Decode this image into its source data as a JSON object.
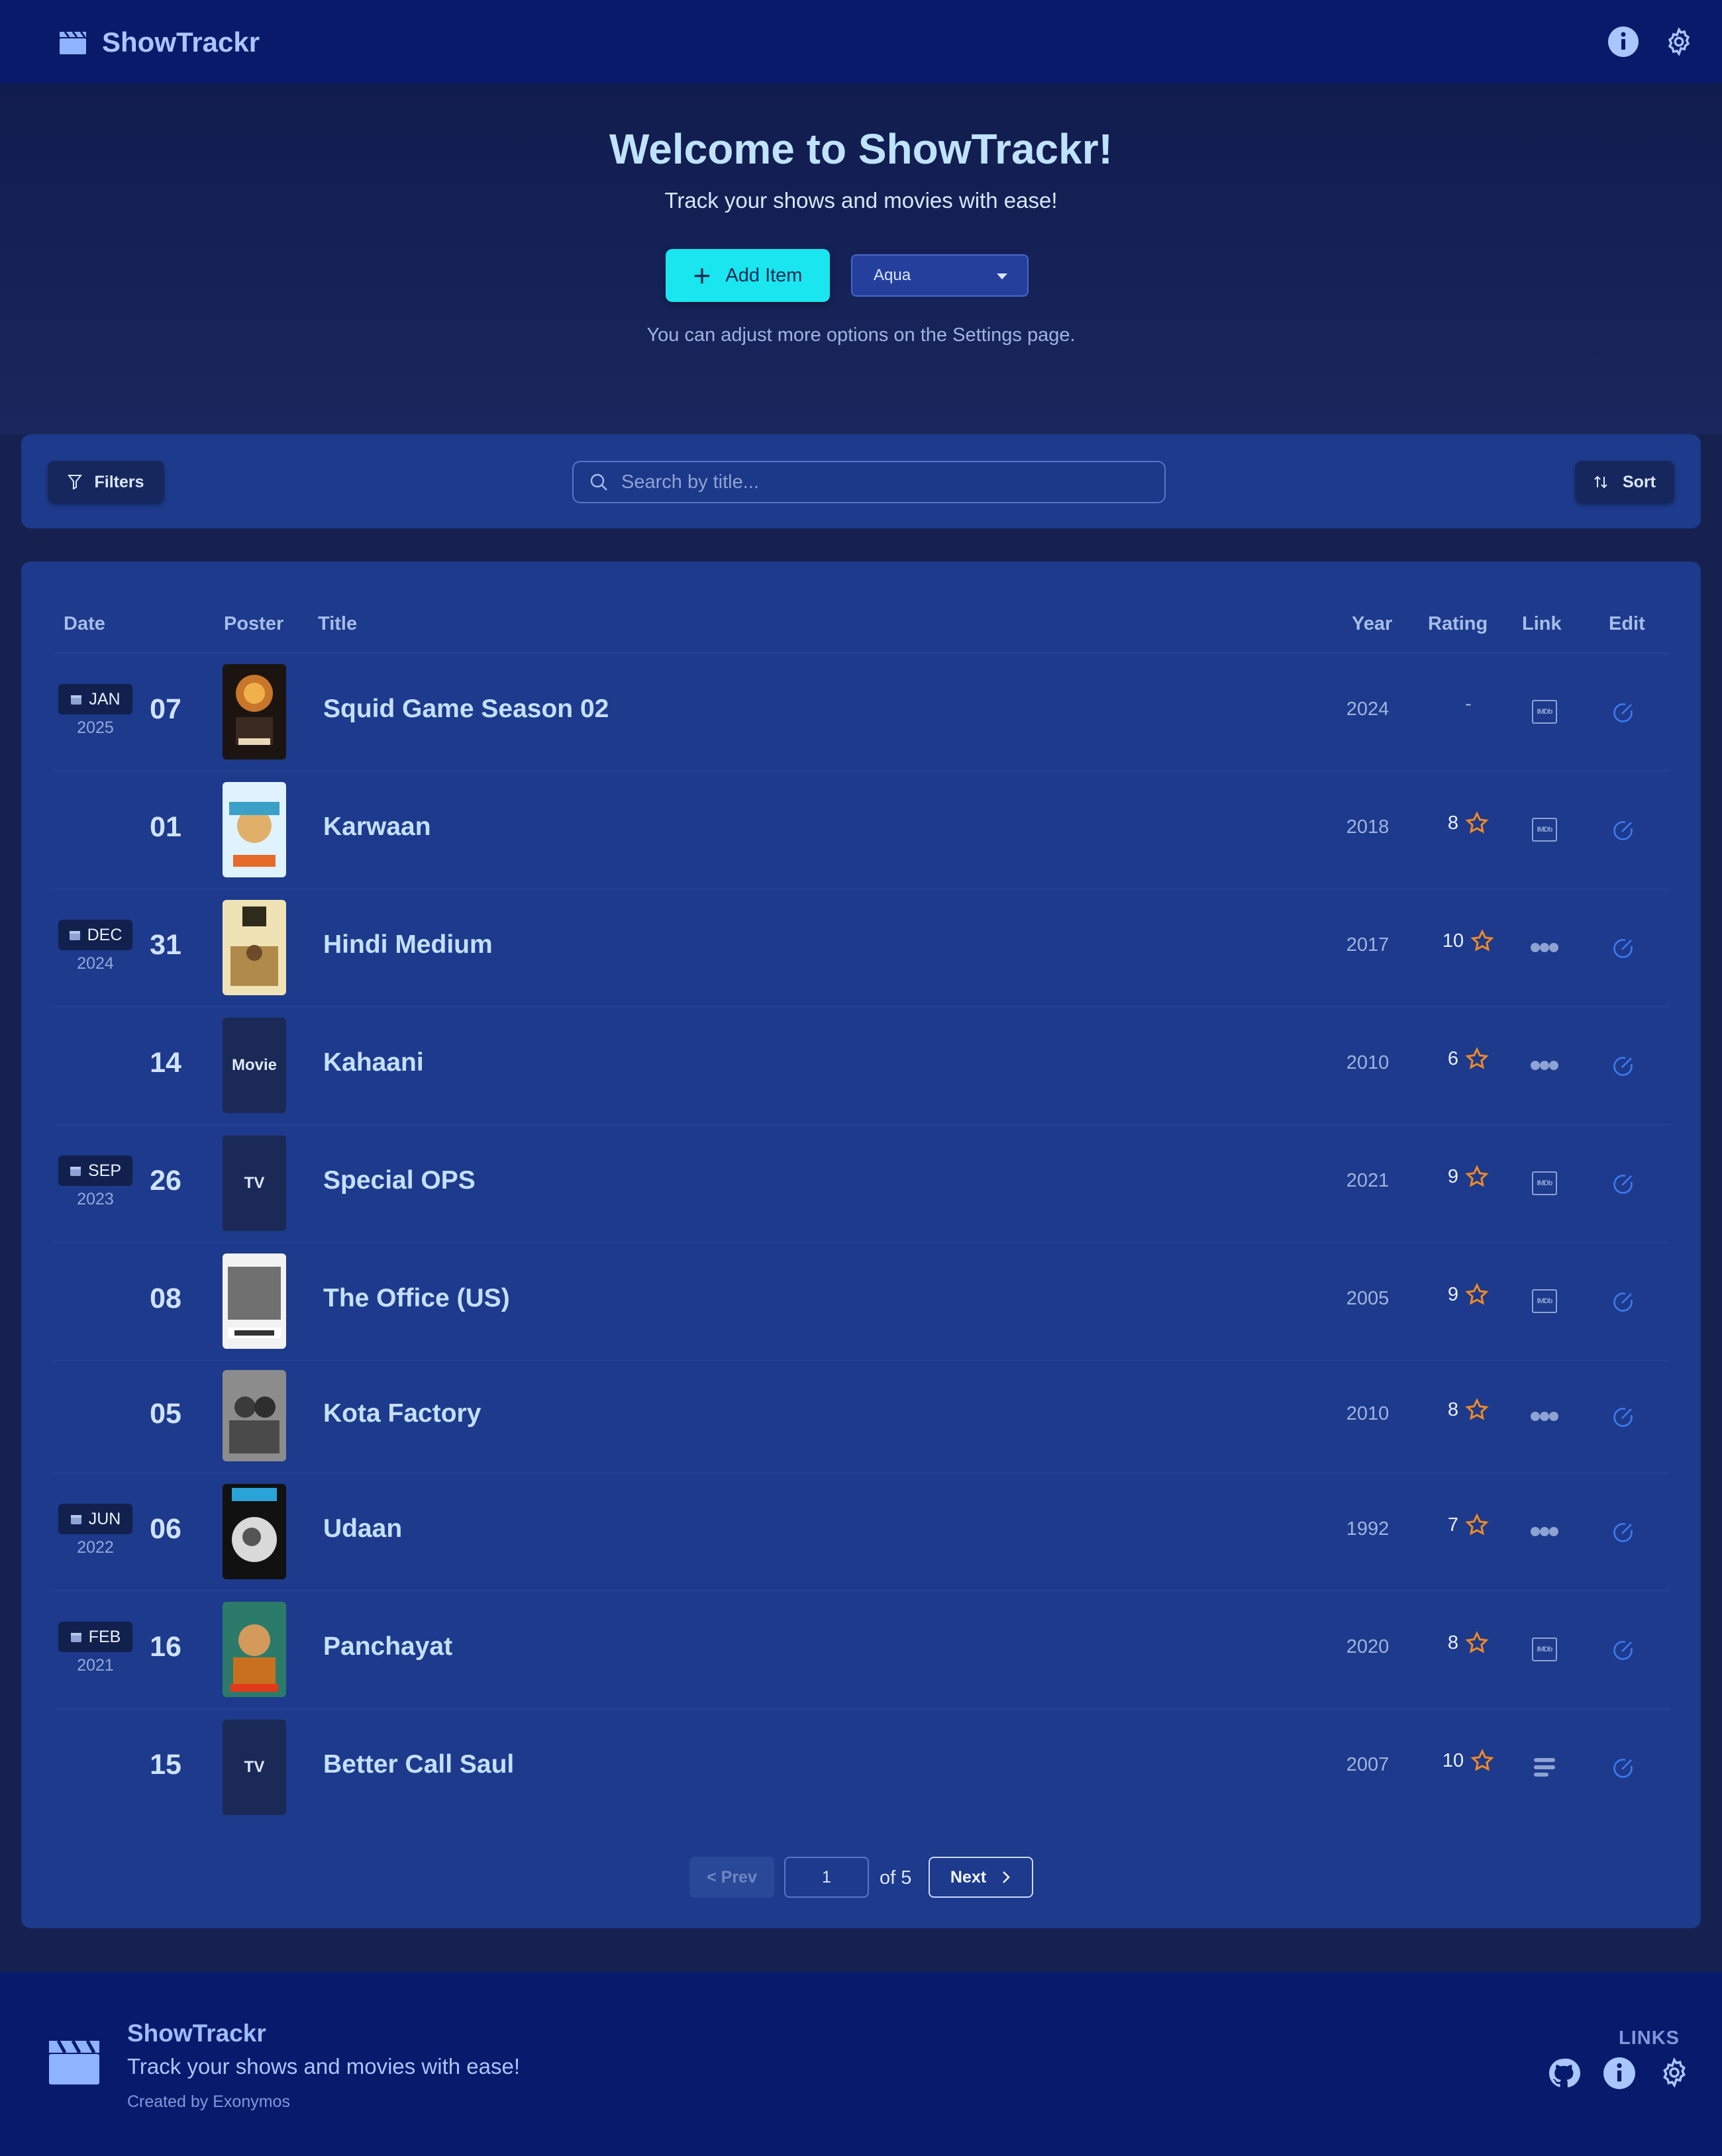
{
  "header": {
    "app_name": "ShowTrackr",
    "icons": [
      "clapperboard-icon",
      "info-icon",
      "settings-icon"
    ]
  },
  "hero": {
    "title": "Welcome to ShowTrackr!",
    "subtitle": "Track your shows and movies with ease!",
    "add_label": "Add Item",
    "theme_value": "Aqua",
    "note": "You can adjust more options on the Settings page."
  },
  "toolbar": {
    "filters_label": "Filters",
    "search_placeholder": "Search by title...",
    "sort_label": "Sort"
  },
  "table": {
    "columns": [
      "Date",
      "Poster",
      "Title",
      "Year",
      "Rating",
      "Link",
      "Edit"
    ],
    "rows": [
      {
        "month": "JAN",
        "year_group": "2025",
        "day": "07",
        "poster": "image",
        "title": "Squid Game Season 02",
        "year": "2024",
        "rating": "-",
        "link": "IMDb"
      },
      {
        "month": "",
        "year_group": "",
        "day": "01",
        "poster": "image",
        "title": "Karwaan",
        "year": "2018",
        "rating": "8",
        "link": "IMDb"
      },
      {
        "month": "DEC",
        "year_group": "2024",
        "day": "31",
        "poster": "image",
        "title": "Hindi Medium",
        "year": "2017",
        "rating": "10",
        "link": "Letterboxd"
      },
      {
        "month": "",
        "year_group": "",
        "day": "14",
        "poster": "Movie",
        "title": "Kahaani",
        "year": "2010",
        "rating": "6",
        "link": "Letterboxd"
      },
      {
        "month": "SEP",
        "year_group": "2023",
        "day": "26",
        "poster": "TV",
        "title": "Special OPS",
        "year": "2021",
        "rating": "9",
        "link": "IMDb"
      },
      {
        "month": "",
        "year_group": "",
        "day": "08",
        "poster": "image",
        "title": "The Office (US)",
        "year": "2005",
        "rating": "9",
        "link": "IMDb"
      },
      {
        "month": "",
        "year_group": "",
        "day": "05",
        "poster": "image",
        "title": "Kota Factory",
        "year": "2010",
        "rating": "8",
        "link": "Letterboxd"
      },
      {
        "month": "JUN",
        "year_group": "2022",
        "day": "06",
        "poster": "image",
        "title": "Udaan",
        "year": "1992",
        "rating": "7",
        "link": "Letterboxd"
      },
      {
        "month": "FEB",
        "year_group": "2021",
        "day": "16",
        "poster": "image",
        "title": "Panchayat",
        "year": "2020",
        "rating": "8",
        "link": "IMDb"
      },
      {
        "month": "",
        "year_group": "",
        "day": "15",
        "poster": "TV",
        "title": "Better Call Saul",
        "year": "2007",
        "rating": "10",
        "link": "TMDB"
      }
    ]
  },
  "pagination": {
    "prev_label": "< Prev",
    "page": "1",
    "of_label": "of 5",
    "next_label": "Next"
  },
  "footer": {
    "app_name": "ShowTrackr",
    "tagline": "Track your shows and movies with ease!",
    "credit": "Created by Exonymos",
    "links_heading": "LINKS",
    "icons": [
      "github-icon",
      "info-icon",
      "settings-icon"
    ]
  },
  "colors": {
    "accent": "#19e6ef",
    "star": "#f08a24",
    "edit": "#3d7bf0",
    "panel": "#1d3a8c",
    "topbar": "#0a1a6b"
  }
}
